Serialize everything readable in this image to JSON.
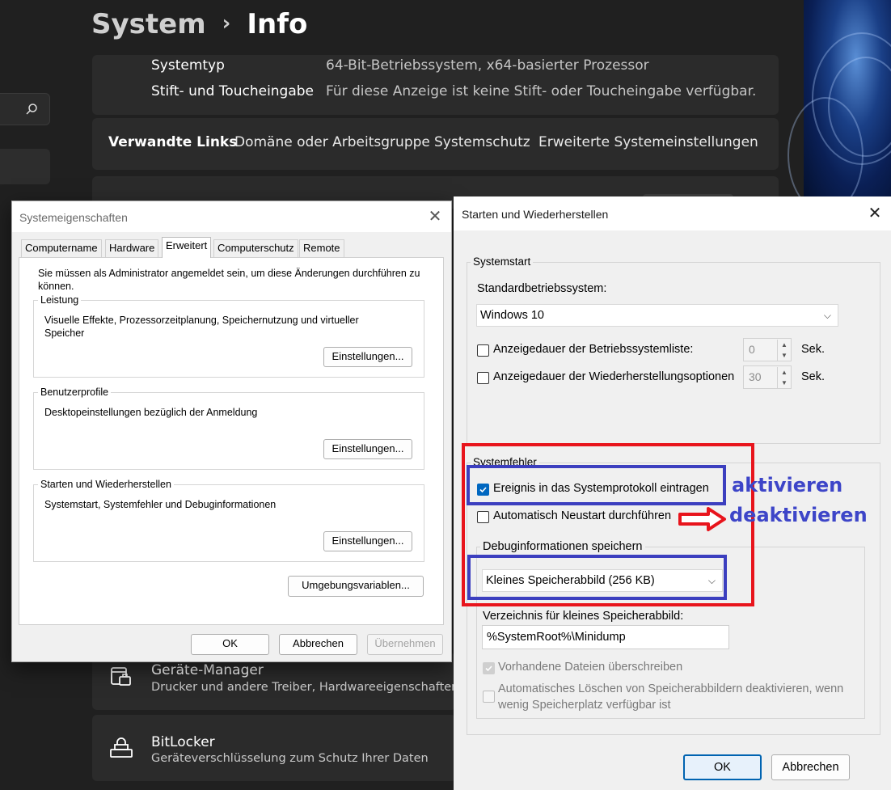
{
  "settings": {
    "breadcrumb_parent": "System",
    "breadcrumb_separator": "›",
    "page_title": "Info",
    "specs": [
      {
        "label": "Systemtyp",
        "value": "64-Bit-Betriebssystem, x64-basierter Prozessor"
      },
      {
        "label": "Stift- und Toucheingabe",
        "value": "Für diese Anzeige ist keine Stift- oder Toucheingabe verfügbar."
      }
    ],
    "related_links": {
      "title": "Verwandte Links",
      "links": [
        "Domäne oder Arbeitsgruppe",
        "Systemschutz",
        "Erweiterte Systemeinstellungen"
      ]
    },
    "cards": [
      {
        "title": "Geräte-Manager",
        "subtitle": "Drucker und andere Treiber, Hardwareeigenschaften",
        "icon": "device-manager-icon"
      },
      {
        "title": "BitLocker",
        "subtitle": "Geräteverschlüsselung zum Schutz Ihrer Daten",
        "icon": "bitlocker-icon"
      }
    ]
  },
  "system_properties": {
    "title": "Systemeigenschaften",
    "close": "✕",
    "tabs": [
      "Computername",
      "Hardware",
      "Erweitert",
      "Computerschutz",
      "Remote"
    ],
    "active_tab": "Erweitert",
    "admin_note": "Sie müssen als Administrator angemeldet sein, um diese Änderungen durchführen zu können.",
    "groups": [
      {
        "legend": "Leistung",
        "text": "Visuelle Effekte, Prozessorzeitplanung, Speichernutzung und virtueller Speicher",
        "button": "Einstellungen..."
      },
      {
        "legend": "Benutzerprofile",
        "text": "Desktopeinstellungen bezüglich der Anmeldung",
        "button": "Einstellungen..."
      },
      {
        "legend": "Starten und Wiederherstellen",
        "text": "Systemstart, Systemfehler und Debuginformationen",
        "button": "Einstellungen..."
      }
    ],
    "env_button": "Umgebungsvariablen...",
    "ok": "OK",
    "cancel": "Abbrechen",
    "apply": "Übernehmen"
  },
  "startup_recovery": {
    "title": "Starten und Wiederherstellen",
    "close": "✕",
    "system_start": {
      "legend": "Systemstart",
      "default_os_label": "Standardbetriebssystem:",
      "default_os_value": "Windows 10",
      "os_list_label": "Anzeigedauer der Betriebssystemliste:",
      "os_list_checked": false,
      "os_list_value": "0",
      "recovery_label": "Anzeigedauer der Wiederherstellungsoptionen",
      "recovery_checked": false,
      "recovery_value": "30",
      "unit": "Sek."
    },
    "system_failure": {
      "legend": "Systemfehler",
      "write_event_label": "Ereignis in das Systemprotokoll eintragen",
      "write_event_checked": true,
      "auto_restart_label": "Automatisch Neustart durchführen",
      "auto_restart_checked": false,
      "debug_legend": "Debuginformationen speichern",
      "debug_value": "Kleines Speicherabbild (256 KB)",
      "dump_dir_label": "Verzeichnis für kleines Speicherabbild:",
      "dump_dir_value": "%SystemRoot%\\Minidump",
      "overwrite_label": "Vorhandene Dateien überschreiben",
      "overwrite_checked": true,
      "disable_autodelete_line1": "Automatisches Löschen von Speicherabbildern deaktivieren, wenn",
      "disable_autodelete_line2": "wenig Speicherplatz verfügbar ist",
      "disable_autodelete_checked": false
    },
    "ok": "OK",
    "cancel": "Abbrechen"
  },
  "annotations": {
    "enable_text": "aktivieren",
    "disable_text": "deaktivieren",
    "highlight_red": "#e8141c",
    "highlight_blue": "#3c3fbf"
  }
}
